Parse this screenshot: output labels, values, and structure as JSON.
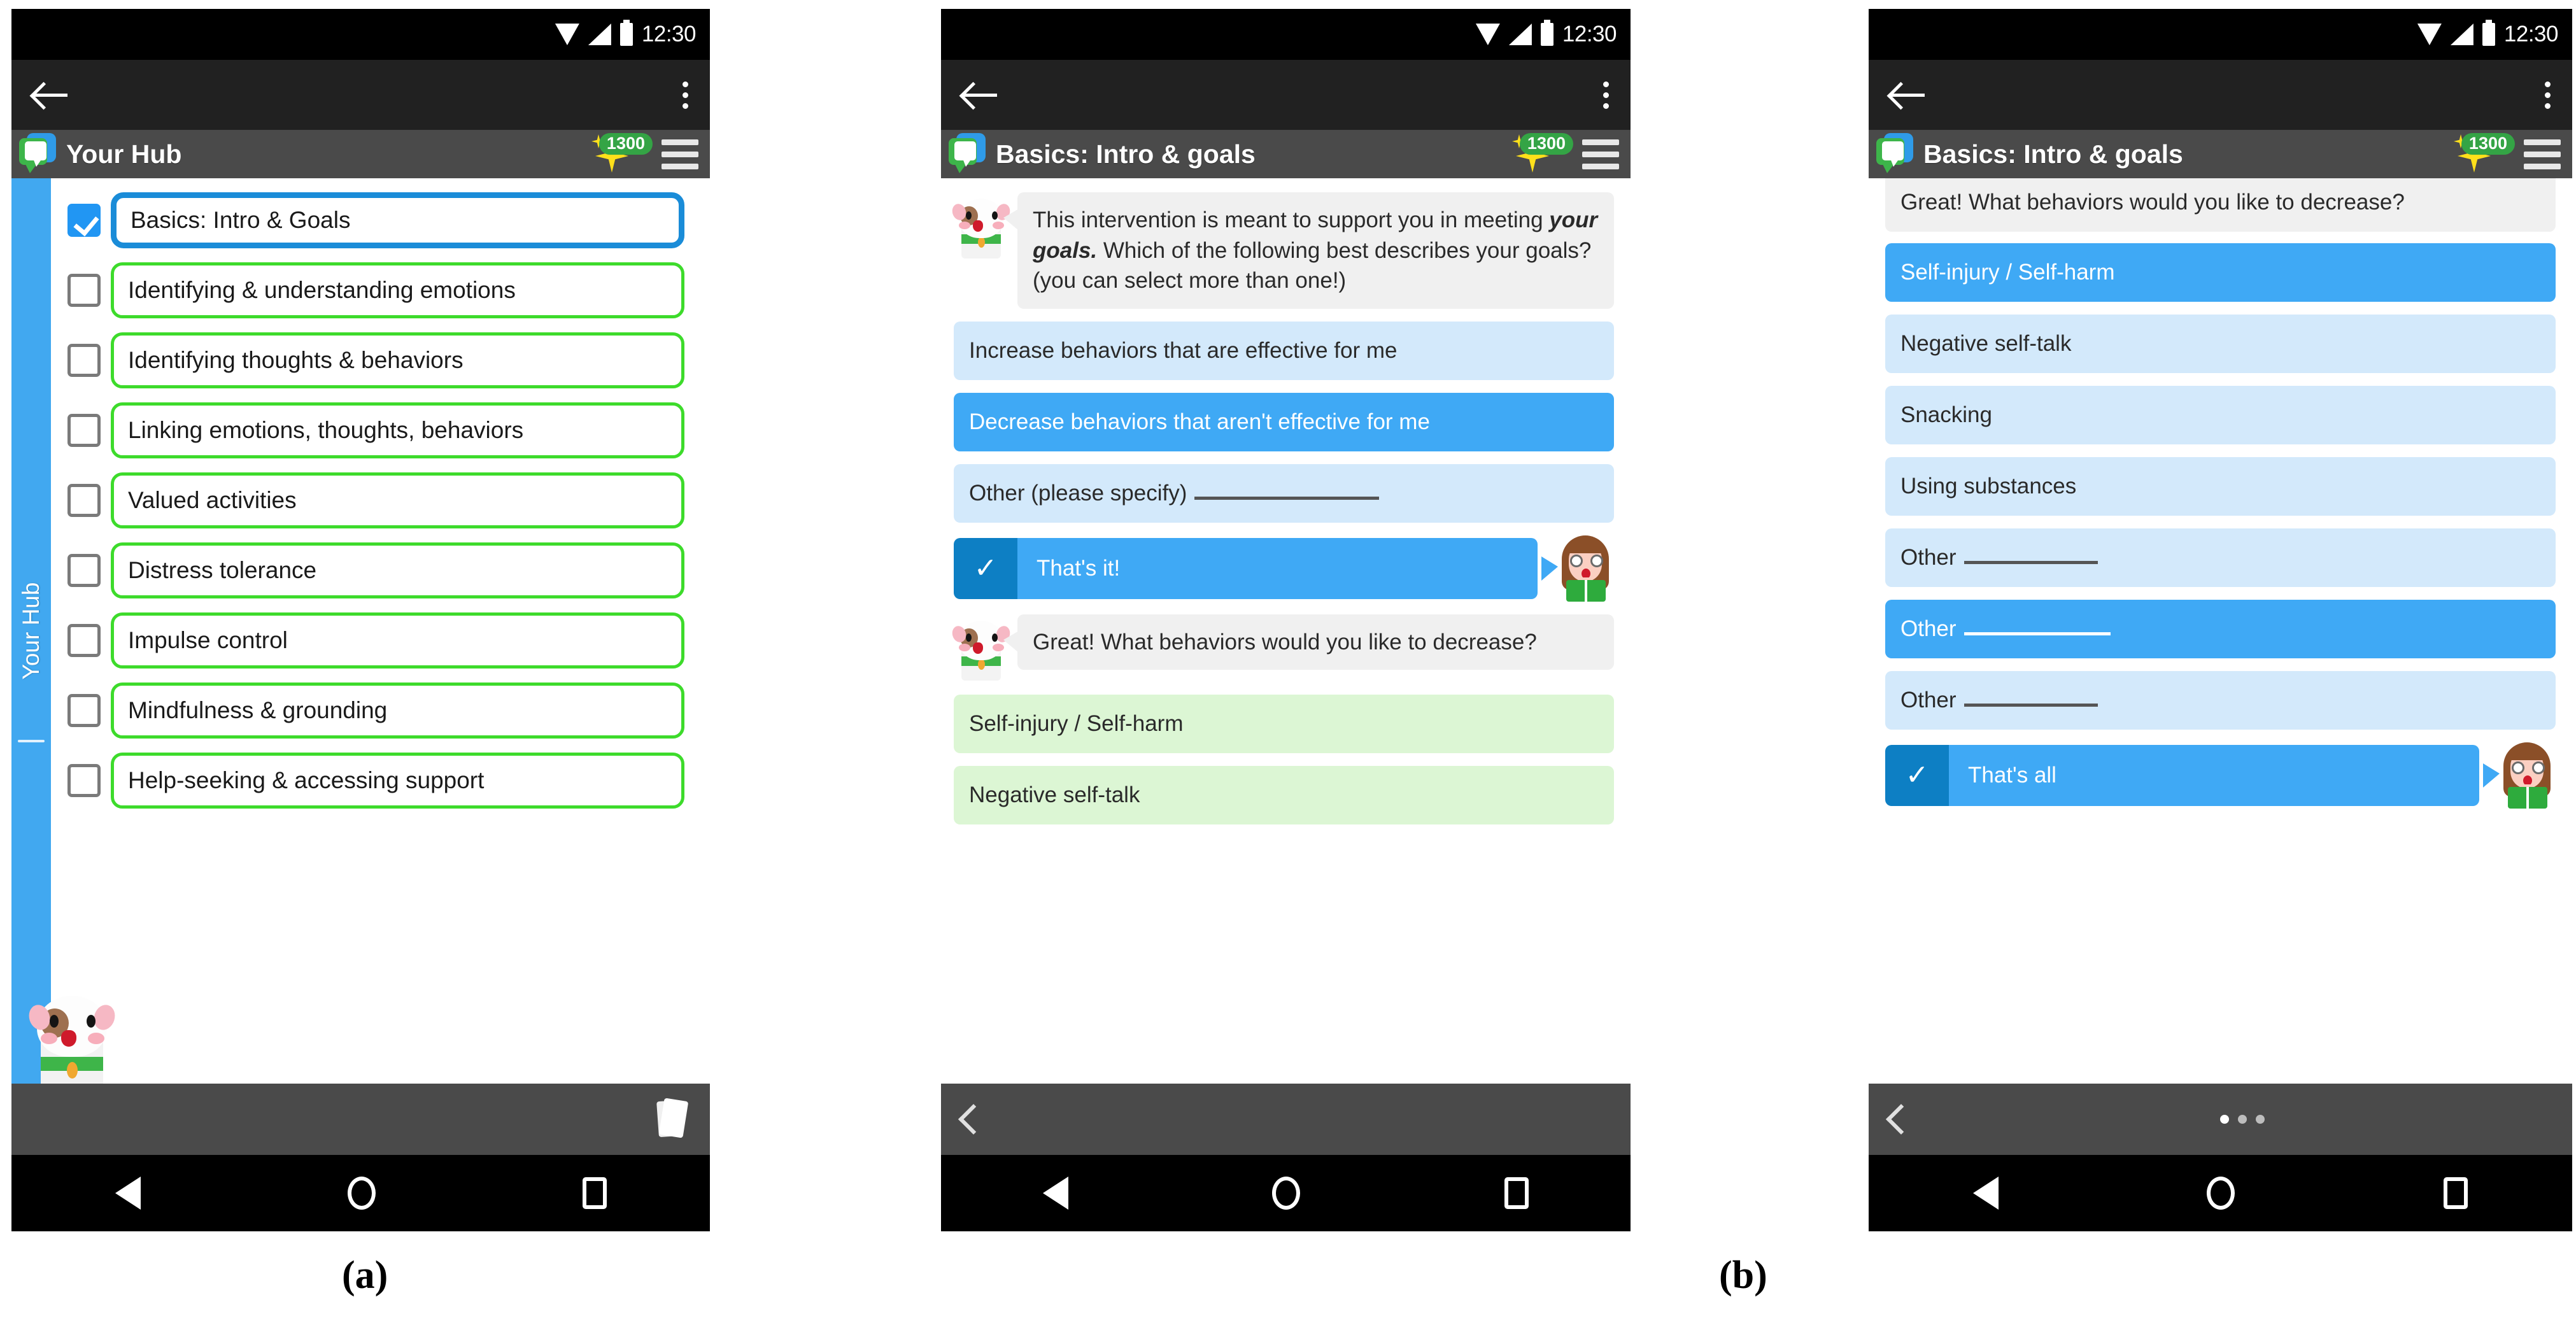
{
  "status_bar": {
    "time": "12:30",
    "icons": [
      "wifi-icon",
      "signal-icon",
      "battery-icon"
    ]
  },
  "panel_a": {
    "caption": "(a)",
    "app_title": "Your Hub",
    "coins": "1300",
    "side_tab_label": "Your Hub",
    "modules": [
      {
        "label": "Basics: Intro & Goals",
        "checked": true,
        "active": true
      },
      {
        "label": "Identifying & understanding emotions",
        "checked": false,
        "active": false
      },
      {
        "label": "Identifying thoughts & behaviors",
        "checked": false,
        "active": false
      },
      {
        "label": "Linking emotions, thoughts, behaviors",
        "checked": false,
        "active": false
      },
      {
        "label": "Valued activities",
        "checked": false,
        "active": false
      },
      {
        "label": "Distress tolerance",
        "checked": false,
        "active": false
      },
      {
        "label": "Impulse control",
        "checked": false,
        "active": false
      },
      {
        "label": "Mindfulness & grounding",
        "checked": false,
        "active": false
      },
      {
        "label": "Help-seeking & accessing support",
        "checked": false,
        "active": false
      }
    ]
  },
  "panel_b_left": {
    "app_title": "Basics: Intro & goals",
    "coins": "1300",
    "bot_message_1_part1": "This intervention is meant to support you in meeting ",
    "bot_message_1_bold": "your goals.",
    "bot_message_1_part2": " Which of the following best describes your goals? (you can select more than one!)",
    "goal_options": [
      {
        "label": "Increase behaviors that are effective for me",
        "selected": false
      },
      {
        "label": "Decrease behaviors that aren't effective for me",
        "selected": true
      },
      {
        "label": "Other (please specify)",
        "selected": false,
        "blank": true
      }
    ],
    "confirm_label": "That's it!",
    "confirm_check": "✓",
    "bot_message_2": "Great! What behaviors would you like to decrease?",
    "behavior_options": [
      {
        "label": "Self-injury / Self-harm"
      },
      {
        "label": "Negative self-talk"
      }
    ]
  },
  "panel_b_right": {
    "caption": "(b)",
    "app_title": "Basics: Intro & goals",
    "coins": "1300",
    "bot_message": "Great! What behaviors would you like to decrease?",
    "behavior_options": [
      {
        "label": "Self-injury / Self-harm",
        "selected": true,
        "blank": false
      },
      {
        "label": "Negative self-talk",
        "selected": false,
        "blank": false
      },
      {
        "label": "Snacking",
        "selected": false,
        "blank": false
      },
      {
        "label": "Using substances",
        "selected": false,
        "blank": false
      },
      {
        "label": "Other",
        "selected": false,
        "blank": true
      },
      {
        "label": "Other",
        "selected": true,
        "blank": true
      },
      {
        "label": "Other",
        "selected": false,
        "blank": true
      }
    ],
    "confirm_label": "That's all",
    "confirm_check": "✓"
  },
  "colors": {
    "accent_blue": "#3fa9f5",
    "selected_blue": "#2196f3",
    "light_blue": "#d3e9fb",
    "light_green": "#dcf6d4",
    "module_green": "#3ddb2b",
    "badge_green": "#34a445",
    "sparkle_yellow": "#ffe01b",
    "toolbar_gray": "#4a4a4a",
    "actionbar_dark": "#212121",
    "bot_bubble_gray": "#f0f0f0"
  }
}
